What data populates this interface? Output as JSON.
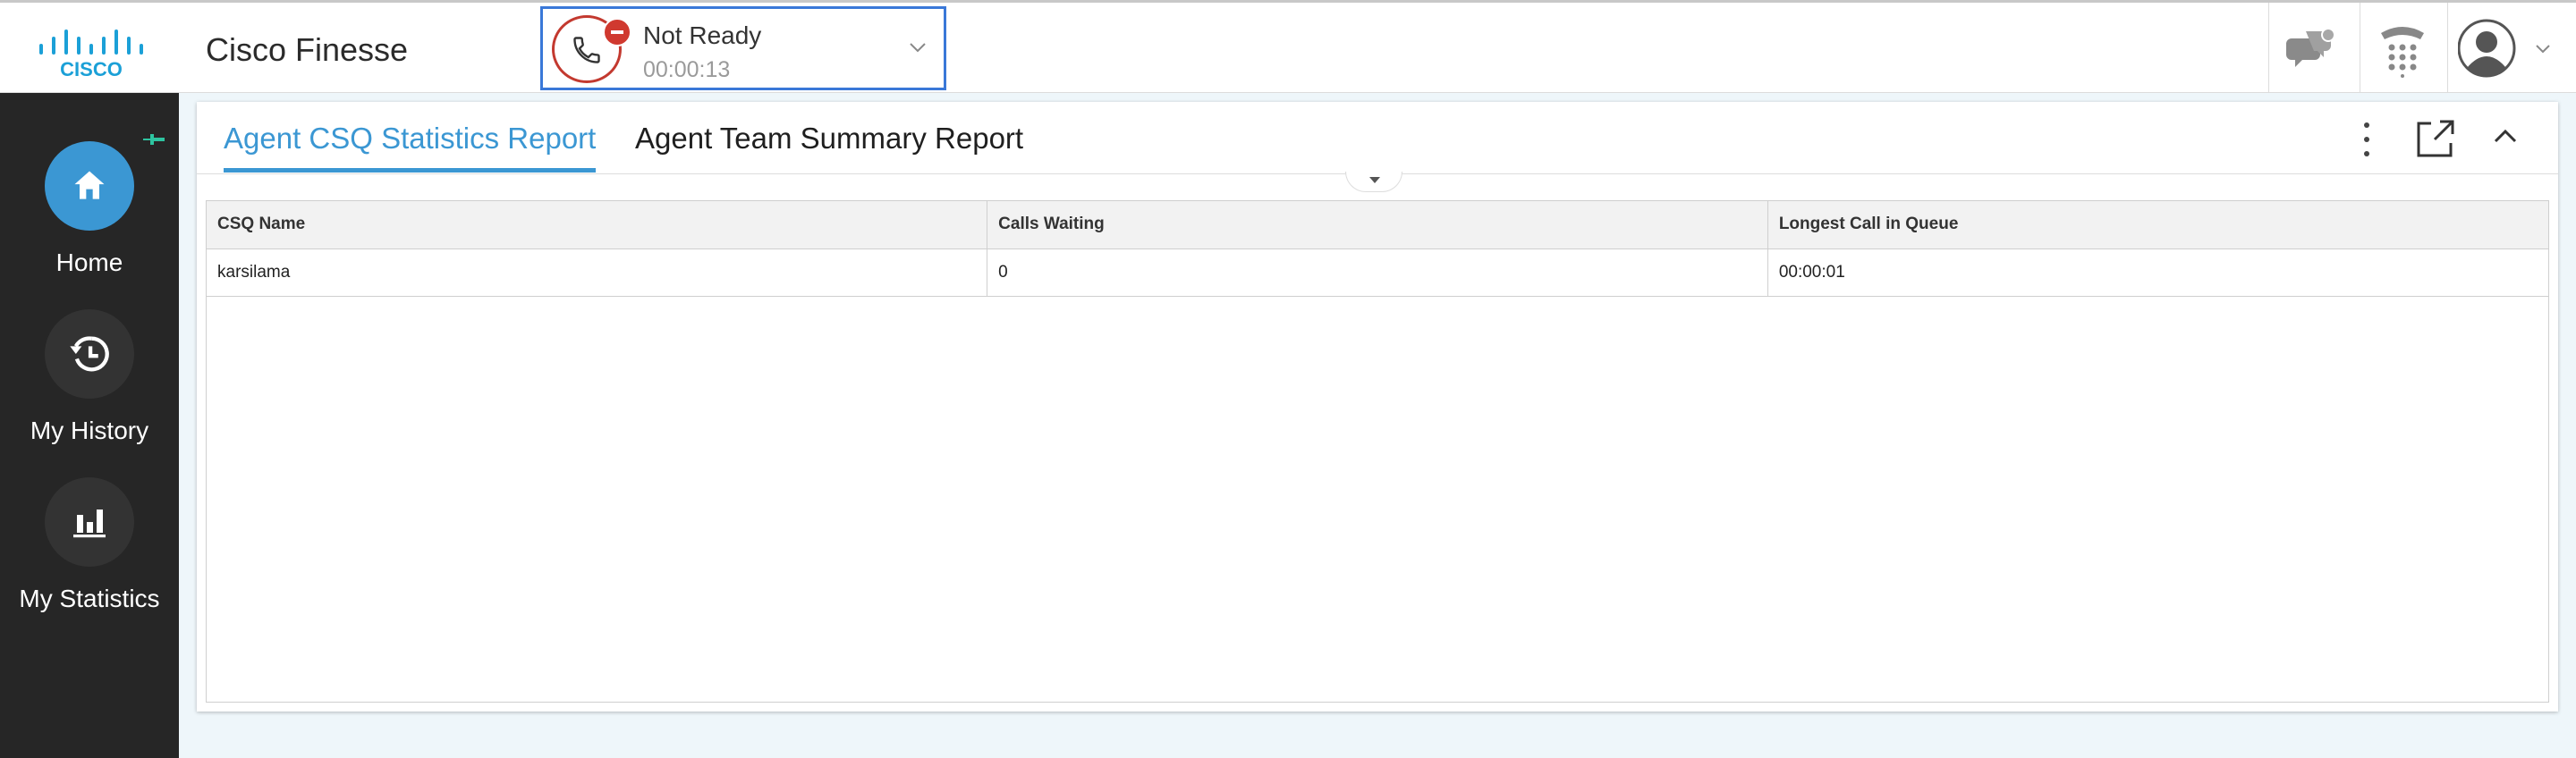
{
  "app": {
    "logo_text": "CISCO",
    "title": "Cisco Finesse"
  },
  "agent_state": {
    "label": "Not Ready",
    "timer": "00:00:13",
    "accent": "#c3392f"
  },
  "toolbar": {
    "icons": [
      "chat-icon",
      "dialpad-icon",
      "user-avatar-icon"
    ]
  },
  "sidebar": {
    "items": [
      {
        "label": "Home",
        "icon": "home-icon",
        "active": true
      },
      {
        "label": "My History",
        "icon": "history-icon",
        "active": false
      },
      {
        "label": "My Statistics",
        "icon": "statistics-icon",
        "active": false
      }
    ]
  },
  "panel": {
    "tabs": [
      {
        "label": "Agent CSQ Statistics Report",
        "active": true
      },
      {
        "label": "Agent Team Summary Report",
        "active": false
      }
    ],
    "table": {
      "columns": [
        "CSQ Name",
        "Calls Waiting",
        "Longest Call in Queue"
      ],
      "rows": [
        [
          "karsilama",
          "0",
          "00:00:01"
        ]
      ]
    }
  },
  "colors": {
    "accent_blue": "#3b97d3",
    "sidebar_bg": "#262626",
    "focus_border": "#3a78d8"
  }
}
